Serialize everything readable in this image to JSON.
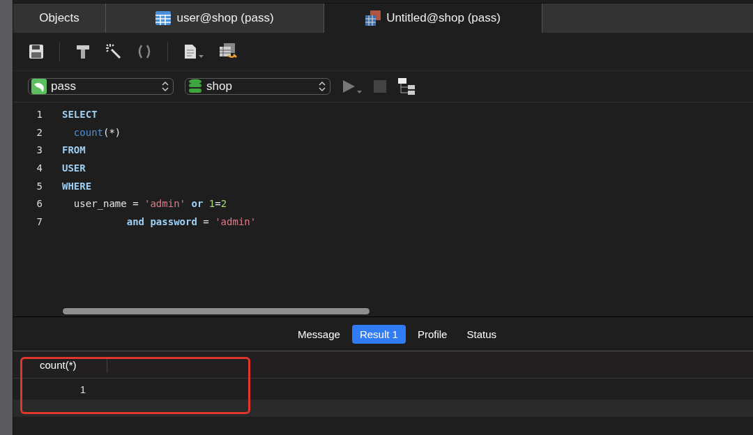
{
  "tabs": [
    {
      "label": "Objects",
      "kind": "plain",
      "selected": false
    },
    {
      "label": "user@shop (pass)",
      "kind": "table",
      "selected": false
    },
    {
      "label": "Untitled@shop (pass)",
      "kind": "query",
      "selected": true
    }
  ],
  "selectors": [
    {
      "kind": "connection",
      "value": "pass"
    },
    {
      "kind": "database",
      "value": "shop"
    }
  ],
  "editor": {
    "lines": [
      {
        "number": "1",
        "tokens": [
          {
            "kind": "keyword",
            "text": "SELECT"
          }
        ]
      },
      {
        "number": "2",
        "tokens": [
          {
            "kind": "function",
            "text": "  count"
          },
          {
            "kind": "plain",
            "text": "(*)"
          }
        ]
      },
      {
        "number": "3",
        "tokens": [
          {
            "kind": "keyword",
            "text": "FROM"
          }
        ]
      },
      {
        "number": "4",
        "tokens": [
          {
            "kind": "keyword",
            "text": "USER"
          }
        ]
      },
      {
        "number": "5",
        "tokens": [
          {
            "kind": "keyword",
            "text": "WHERE"
          }
        ]
      },
      {
        "number": "6",
        "tokens": [
          {
            "kind": "plain",
            "text": "  user_name = "
          },
          {
            "kind": "string",
            "text": "'admin'"
          },
          {
            "kind": "keyword",
            "text": " or"
          },
          {
            "kind": "number",
            "text": " 1"
          },
          {
            "kind": "plain",
            "text": "="
          },
          {
            "kind": "number",
            "text": "2"
          }
        ]
      },
      {
        "number": "7",
        "tokens": [
          {
            "kind": "keyword",
            "text": "           and password"
          },
          {
            "kind": "plain",
            "text": " = "
          },
          {
            "kind": "string",
            "text": "'admin'"
          }
        ]
      }
    ]
  },
  "result_tabs": [
    {
      "label": "Message",
      "selected": false
    },
    {
      "label": "Result 1",
      "selected": true
    },
    {
      "label": "Profile",
      "selected": false
    },
    {
      "label": "Status",
      "selected": false
    }
  ],
  "table": {
    "columns": [
      "count(*)"
    ],
    "rows": [
      [
        "1"
      ]
    ]
  },
  "annotation": {
    "kind": "outline",
    "color": "#e0362c"
  }
}
